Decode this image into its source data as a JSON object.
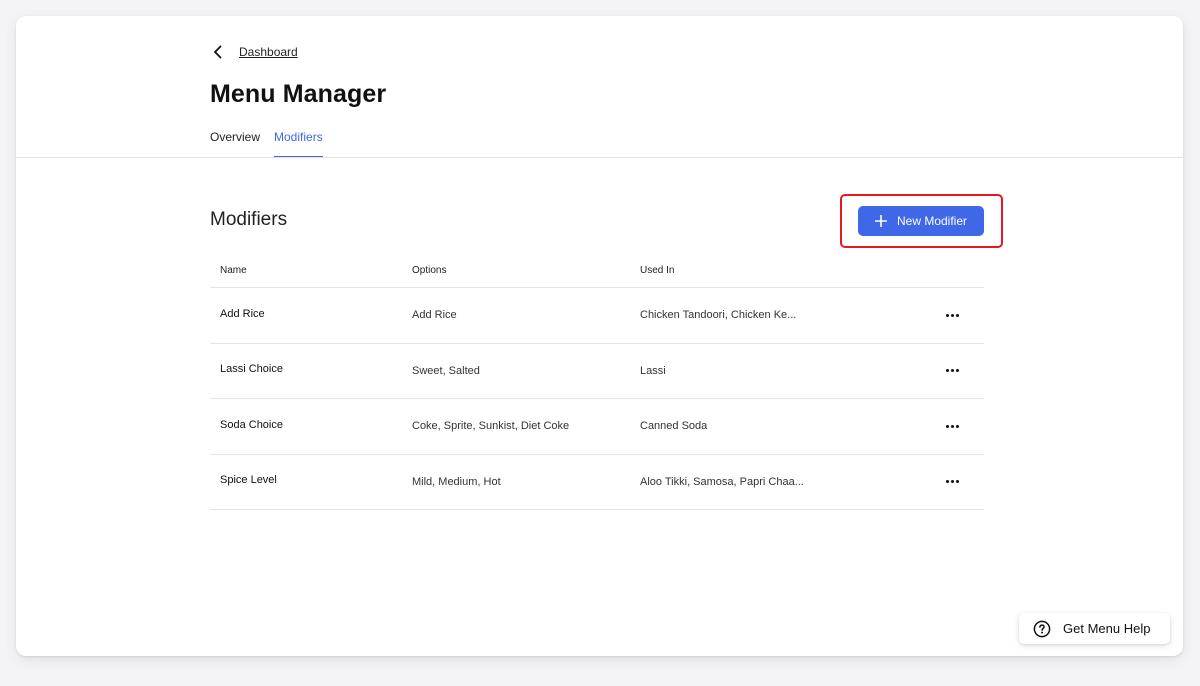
{
  "breadcrumb": {
    "back_label": "Dashboard"
  },
  "page": {
    "title": "Menu Manager"
  },
  "tabs": [
    {
      "label": "Overview",
      "active": false
    },
    {
      "label": "Modifiers",
      "active": true
    }
  ],
  "section": {
    "title": "Modifiers"
  },
  "actions": {
    "new_label": "New Modifier"
  },
  "table": {
    "columns": [
      "Name",
      "Options",
      "Used In",
      ""
    ],
    "rows": [
      {
        "name": "Add Rice",
        "options": "Add Rice",
        "used_in": "Chicken Tandoori, Chicken Ke..."
      },
      {
        "name": "Lassi Choice",
        "options": "Sweet, Salted",
        "used_in": "Lassi"
      },
      {
        "name": "Soda Choice",
        "options": "Coke, Sprite, Sunkist, Diet Coke",
        "used_in": "Canned Soda"
      },
      {
        "name": "Spice Level",
        "options": "Mild, Medium, Hot",
        "used_in": "Aloo Tikki, Samosa, Papri Chaa..."
      }
    ]
  },
  "help": {
    "label": "Get Menu Help"
  },
  "colors": {
    "accent": "#3f68e8",
    "highlight": "#e5171f"
  },
  "icons": [
    "chevron-left-icon",
    "plus-icon",
    "more-horizontal-icon",
    "question-circle-icon"
  ]
}
